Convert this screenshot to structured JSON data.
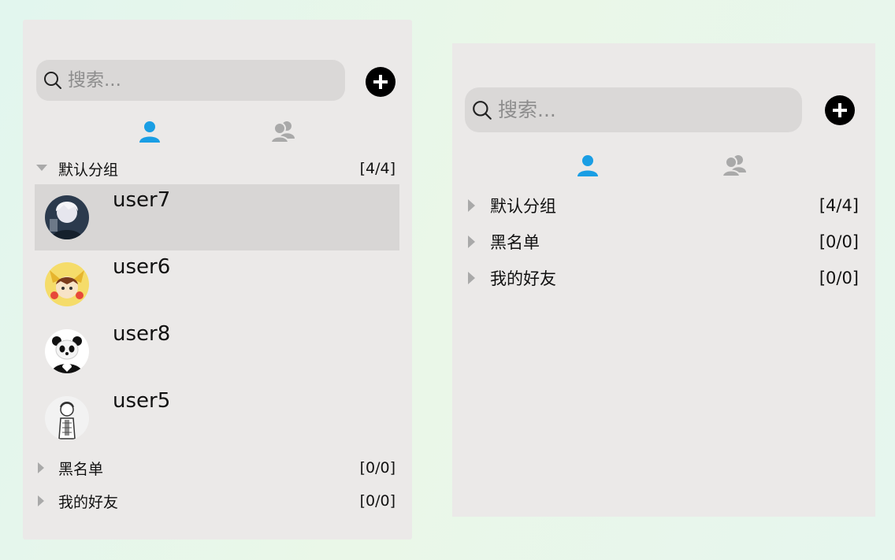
{
  "left_panel": {
    "search_placeholder": "搜索...",
    "groups": [
      {
        "name": "默认分组",
        "count": "[4/4]",
        "expanded": true
      },
      {
        "name": "黑名单",
        "count": "[0/0]",
        "expanded": false
      },
      {
        "name": "我的好友",
        "count": "[0/0]",
        "expanded": false
      }
    ],
    "friends": [
      {
        "name": "user7",
        "selected": true
      },
      {
        "name": "user6",
        "selected": false
      },
      {
        "name": "user8",
        "selected": false
      },
      {
        "name": "user5",
        "selected": false
      }
    ]
  },
  "right_panel": {
    "search_placeholder": "搜索...",
    "groups": [
      {
        "name": "默认分组",
        "count": "[4/4]",
        "expanded": false
      },
      {
        "name": "黑名单",
        "count": "[0/0]",
        "expanded": false
      },
      {
        "name": "我的好友",
        "count": "[0/0]",
        "expanded": false
      }
    ]
  },
  "colors": {
    "active_tab": "#1a9ee4",
    "inactive_tab": "#a9a9a9",
    "selected_row": "#d8d6d5",
    "panel_bg": "#ebe9e8"
  }
}
